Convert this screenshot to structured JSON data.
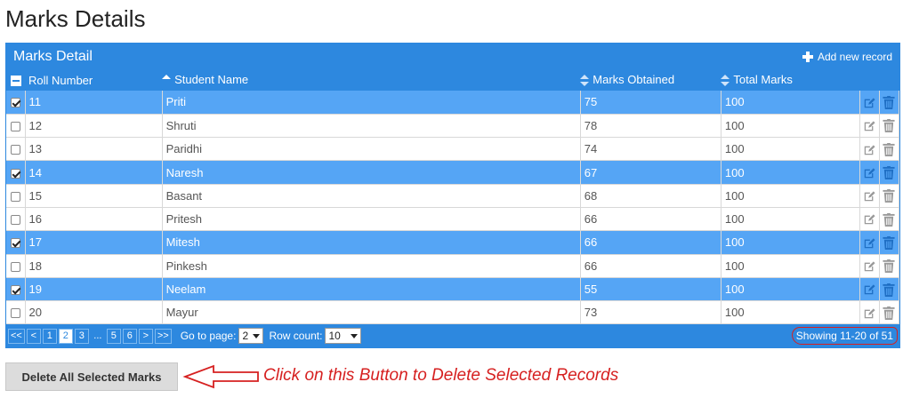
{
  "page": {
    "title": "Marks Details"
  },
  "grid": {
    "caption": "Marks Detail",
    "add_label": "Add new record",
    "columns": {
      "roll": "Roll Number",
      "name": "Student Name",
      "marks": "Marks Obtained",
      "total": "Total Marks"
    },
    "rows": [
      {
        "roll": "11",
        "name": "Priti",
        "marks": "75",
        "total": "100",
        "selected": true
      },
      {
        "roll": "12",
        "name": "Shruti",
        "marks": "78",
        "total": "100",
        "selected": false
      },
      {
        "roll": "13",
        "name": "Paridhi",
        "marks": "74",
        "total": "100",
        "selected": false
      },
      {
        "roll": "14",
        "name": "Naresh",
        "marks": "67",
        "total": "100",
        "selected": true
      },
      {
        "roll": "15",
        "name": "Basant",
        "marks": "68",
        "total": "100",
        "selected": false
      },
      {
        "roll": "16",
        "name": "Pritesh",
        "marks": "66",
        "total": "100",
        "selected": false
      },
      {
        "roll": "17",
        "name": "Mitesh",
        "marks": "66",
        "total": "100",
        "selected": true
      },
      {
        "roll": "18",
        "name": "Pinkesh",
        "marks": "66",
        "total": "100",
        "selected": false
      },
      {
        "roll": "19",
        "name": "Neelam",
        "marks": "55",
        "total": "100",
        "selected": true
      },
      {
        "roll": "20",
        "name": "Mayur",
        "marks": "73",
        "total": "100",
        "selected": false
      }
    ]
  },
  "pager": {
    "first": "<<",
    "prev": "<",
    "pages": [
      "1",
      "2",
      "3",
      "...",
      "5",
      "6"
    ],
    "current_page": "2",
    "next": ">",
    "last": ">>",
    "goto_label": "Go to page:",
    "goto_value": "2",
    "rowcount_label": "Row count:",
    "rowcount_value": "10",
    "showing": "Showing 11-20 of 51"
  },
  "actions": {
    "delete_label": "Delete All Selected Marks"
  },
  "annotation": {
    "text": "Click on this Button to Delete Selected Records"
  },
  "colors": {
    "header_blue": "#2d88df",
    "selected_row": "#55a5f5",
    "annotation_red": "#d62020"
  }
}
